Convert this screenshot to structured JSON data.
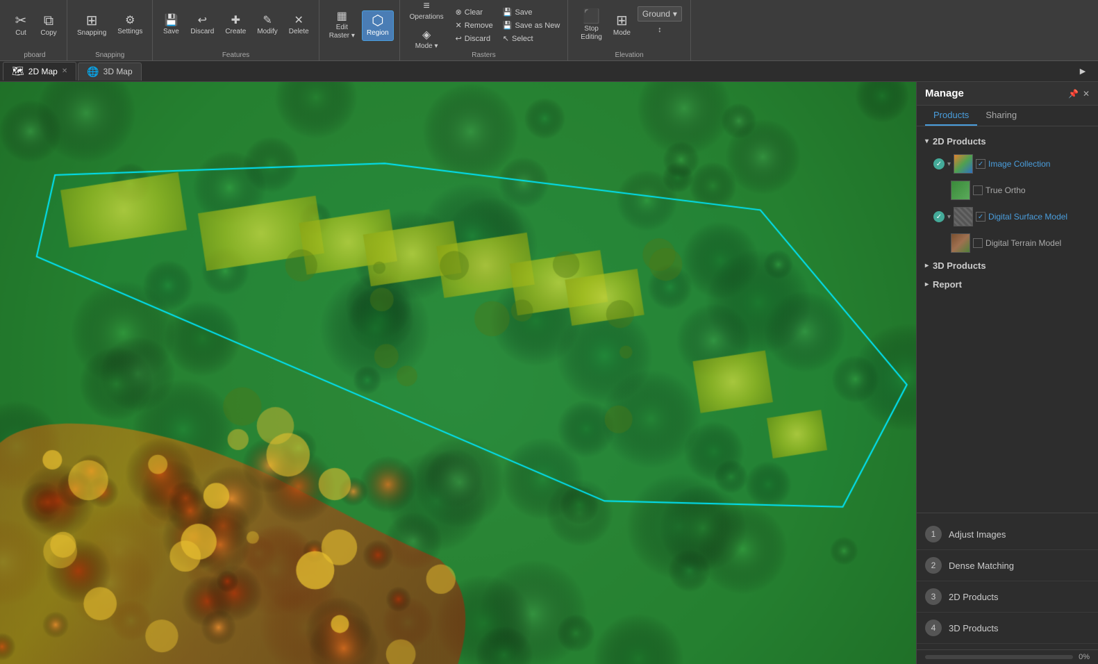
{
  "toolbar": {
    "groups": [
      {
        "label": "pboard",
        "items": [
          {
            "id": "cut",
            "icon": "✂",
            "label": "Cut"
          },
          {
            "id": "copy",
            "icon": "⧉",
            "label": "Copy"
          }
        ]
      },
      {
        "label": "Snapping",
        "items": [
          {
            "id": "snapping",
            "icon": "⊞",
            "label": "Snapping"
          },
          {
            "id": "settings",
            "icon": "⚙",
            "label": "Settings"
          }
        ]
      },
      {
        "label": "Features",
        "items": [
          {
            "id": "save",
            "icon": "💾",
            "label": "Save"
          },
          {
            "id": "discard",
            "icon": "⟳",
            "label": "Discard"
          },
          {
            "id": "create",
            "icon": "✚",
            "label": "Create"
          },
          {
            "id": "modify",
            "icon": "✎",
            "label": "Modify"
          },
          {
            "id": "delete",
            "icon": "✕",
            "label": "Delete"
          }
        ]
      },
      {
        "label": "",
        "items": [
          {
            "id": "edit-raster",
            "icon": "▦",
            "label": "Edit\nRaster",
            "hasArrow": true
          },
          {
            "id": "region",
            "icon": "⬡",
            "label": "Region",
            "active": true
          }
        ]
      },
      {
        "label": "Rasters",
        "items": [
          {
            "id": "operations",
            "icon": "≡",
            "label": "Operations"
          },
          {
            "id": "mode",
            "icon": "◈",
            "label": "Mode"
          }
        ],
        "rasterItems": [
          {
            "id": "clear",
            "icon": "⊗",
            "label": "Clear"
          },
          {
            "id": "remove",
            "icon": "✕",
            "label": "Remove"
          },
          {
            "id": "discard-r",
            "icon": "⟳",
            "label": "Discard"
          },
          {
            "id": "save-r",
            "icon": "💾",
            "label": "Save"
          },
          {
            "id": "save-as-new",
            "icon": "💾",
            "label": "Save as\nNew"
          },
          {
            "id": "select",
            "icon": "↖",
            "label": "Select"
          }
        ]
      },
      {
        "label": "Elevation",
        "items": [
          {
            "id": "stop-editing",
            "icon": "⬛",
            "label": "Stop\nEditing",
            "active": false
          },
          {
            "id": "mode-btn",
            "icon": "⊞",
            "label": "Mode"
          }
        ],
        "dropdown": "Ground",
        "extraIcon": "↕"
      }
    ]
  },
  "tabs": [
    {
      "id": "2d-map",
      "label": "2D Map",
      "icon": "🗺",
      "active": true,
      "closable": true
    },
    {
      "id": "3d-map",
      "label": "3D Map",
      "icon": "🌐",
      "active": false,
      "closable": false
    }
  ],
  "panel": {
    "title": "Manage",
    "tabs": [
      {
        "id": "products",
        "label": "Products",
        "active": true
      },
      {
        "id": "sharing",
        "label": "Sharing",
        "active": false
      }
    ],
    "sections": [
      {
        "id": "2d-products",
        "label": "2D Products",
        "expanded": true,
        "items": [
          {
            "id": "image-collection",
            "label": "Image Collection",
            "checked": true,
            "statusDot": true,
            "thumbClass": "thumb-color",
            "expandable": true
          },
          {
            "id": "true-ortho",
            "label": "True Ortho",
            "checked": false,
            "statusDot": false,
            "thumbClass": "thumb-green",
            "sub": true,
            "expandable": false
          },
          {
            "id": "digital-surface-model",
            "label": "Digital Surface Model",
            "checked": true,
            "statusDot": true,
            "thumbClass": "thumb-gray-stripes",
            "expandable": true
          },
          {
            "id": "digital-terrain-model",
            "label": "Digital Terrain Model",
            "checked": false,
            "statusDot": false,
            "thumbClass": "thumb-terrain",
            "sub": true,
            "expandable": false
          }
        ]
      },
      {
        "id": "3d-products",
        "label": "3D Products",
        "expanded": false,
        "items": []
      },
      {
        "id": "report",
        "label": "Report",
        "expanded": false,
        "items": []
      }
    ],
    "workflowSteps": [
      {
        "num": "1",
        "label": "Adjust Images"
      },
      {
        "num": "2",
        "label": "Dense Matching"
      },
      {
        "num": "3",
        "label": "2D Products"
      },
      {
        "num": "4",
        "label": "3D Products"
      }
    ],
    "progress": {
      "value": 0,
      "label": "0%"
    }
  }
}
